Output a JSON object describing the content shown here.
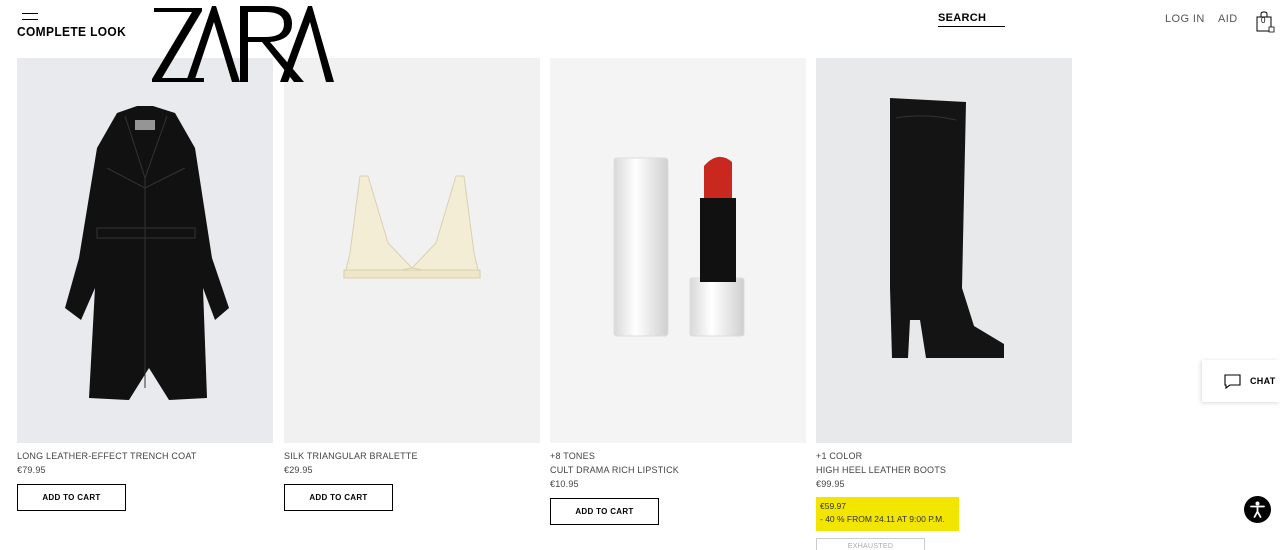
{
  "header": {
    "menu_icon": "hamburger-icon",
    "page_title": "COMPLETE LOOK",
    "logo_text": "ZARA",
    "search_label": "SEARCH",
    "login_label": "LOG IN",
    "help_label": "AID",
    "cart_icon": "shopping-bag-icon",
    "cart_count": "0"
  },
  "products": [
    {
      "image": "black-trench-coat",
      "name": "LONG LEATHER-EFFECT TRENCH COAT",
      "price": "€79.95",
      "button_label": "ADD TO CART"
    },
    {
      "image": "sheer-bralette",
      "name": "SILK TRIANGULAR BRALETTE",
      "price": "€29.95",
      "button_label": "ADD TO CART"
    },
    {
      "image": "red-lipstick",
      "variants": "+8 TONES",
      "name": "CULT DRAMA RICH LIPSTICK",
      "price": "€10.95",
      "button_label": "ADD TO CART"
    },
    {
      "image": "black-leather-boot",
      "variants": "+1 COLOR",
      "name": "HIGH HEEL LEATHER BOOTS",
      "price": "€99.95",
      "sale_price": "€59.97",
      "sale_note": "- 40 % FROM 24.11 AT 9:00 P.M.",
      "button_label": "EXHAUSTED"
    }
  ],
  "chat": {
    "icon": "chat-bubble-icon",
    "label": "CHAT"
  },
  "accessibility": {
    "icon": "accessibility-icon"
  },
  "colors": {
    "promo": "#f2e600",
    "background": "#ffffff",
    "photo_bg": "#efeff1",
    "lipstick": "#c8281e"
  }
}
